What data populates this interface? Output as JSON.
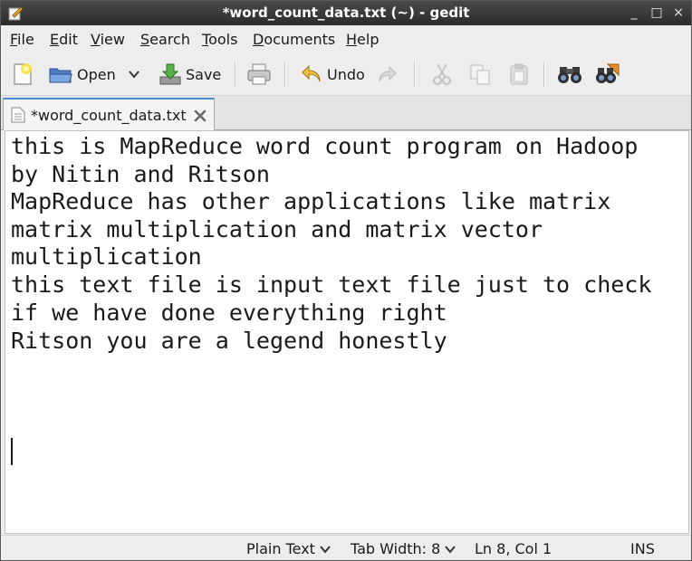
{
  "window": {
    "title": "*word_count_data.txt (~) - gedit",
    "controls": {
      "minimize": "_",
      "maximize": "□",
      "close": "×"
    }
  },
  "menu": [
    {
      "label": "File",
      "mnemonic": "F",
      "rest": "ile"
    },
    {
      "label": "Edit",
      "mnemonic": "E",
      "rest": "dit"
    },
    {
      "label": "View",
      "mnemonic": "V",
      "rest": "iew"
    },
    {
      "label": "Search",
      "mnemonic": "S",
      "rest": "earch"
    },
    {
      "label": "Tools",
      "mnemonic": "T",
      "rest": "ools"
    },
    {
      "label": "Documents",
      "mnemonic": "D",
      "rest": "ocuments"
    },
    {
      "label": "Help",
      "mnemonic": "H",
      "rest": "elp"
    }
  ],
  "toolbar": {
    "open_label": "Open",
    "save_label": "Save",
    "undo_label": "Undo"
  },
  "tab": {
    "label": "*word_count_data.txt"
  },
  "editor": {
    "lines": [
      "this is MapReduce word count program on Hadoop",
      "by Nitin and Ritson",
      "MapReduce has other applications like matrix",
      "matrix multiplication and matrix vector",
      "multiplication",
      "this text file is input text file just to check",
      "if we have done everything right",
      "Ritson you are a legend honestly"
    ]
  },
  "statusbar": {
    "language": "Plain Text",
    "tab_width_label": "Tab Width:",
    "tab_width_value": "8",
    "position": "Ln 8, Col 1",
    "mode": "INS"
  }
}
